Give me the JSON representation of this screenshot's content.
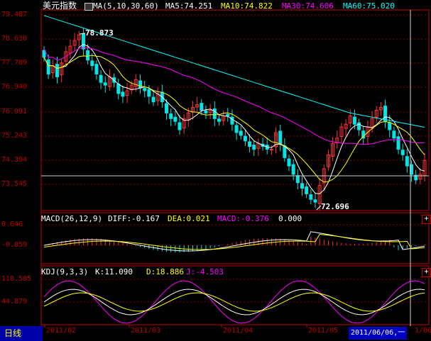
{
  "main": {
    "title": "美元指数",
    "ma_label": "MA(5,10,30,60)",
    "ma5": "MA5:74.251",
    "ma10": "MA10:74.822",
    "ma30": "MA30:74.606",
    "ma60": "MA60:75.020",
    "high_marker": "78.873",
    "low_marker": "72.696",
    "y_ticks": [
      "79.487",
      "78.630",
      "77.789",
      "76.940",
      "76.091",
      "75.243",
      "74.394",
      "73.545"
    ]
  },
  "macd": {
    "label": "MACD(26,12,9)",
    "diff": "DIFF:-0.167",
    "dea": "DEA:0.021",
    "macd": "MACD:-0.376",
    "extra": "0.000",
    "y_ticks": [
      "0.646",
      "-0.059"
    ]
  },
  "kdj": {
    "label": "KDJ(9,3,3)",
    "k": "K:11.090",
    "d": "D:18.886",
    "j": "J:-4.503",
    "y_ticks": [
      "110.585",
      "44.879"
    ]
  },
  "bottom": {
    "tab": "日线",
    "dates": [
      "2011/02",
      "2011/03",
      "2011/04",
      "2011/05"
    ],
    "cursor_date": "2011/06/06,一",
    "tail": "1/06"
  },
  "colors": {
    "up": "#ff3333",
    "down": "#00e5e5",
    "ma5": "#ffffff",
    "ma10": "#ffff00",
    "ma30": "#ff00ff",
    "ma60": "#00ffff",
    "grid": "#8b0000",
    "frame": "#c00000"
  },
  "chart_data": {
    "type": "candlestick",
    "ylim": [
      72.4,
      79.6
    ],
    "closes": [
      77.9,
      77.3,
      77.6,
      77.2,
      77.7,
      78.1,
      78.3,
      78.5,
      78.7,
      78.2,
      77.8,
      77.6,
      77.3,
      77.0,
      76.9,
      77.2,
      77.0,
      76.6,
      76.5,
      76.7,
      76.9,
      77.1,
      76.8,
      76.7,
      76.5,
      76.3,
      76.6,
      76.3,
      75.9,
      75.7,
      75.6,
      75.3,
      75.7,
      75.9,
      76.1,
      76.2,
      76.0,
      75.9,
      76.0,
      75.7,
      75.6,
      75.8,
      75.8,
      75.5,
      75.2,
      75.1,
      74.9,
      74.7,
      74.6,
      74.8,
      74.7,
      74.6,
      74.6,
      75.2,
      74.8,
      74.3,
      74.0,
      73.7,
      73.4,
      73.2,
      73.0,
      72.8,
      72.7,
      73.3,
      73.9,
      74.4,
      74.8,
      75.0,
      75.4,
      75.5,
      75.8,
      75.5,
      75.3,
      75.0,
      75.4,
      75.7,
      76.0,
      76.1,
      75.6,
      75.3,
      75.0,
      74.6,
      74.4,
      74.0,
      73.7,
      73.5,
      73.7,
      74.2
    ]
  }
}
